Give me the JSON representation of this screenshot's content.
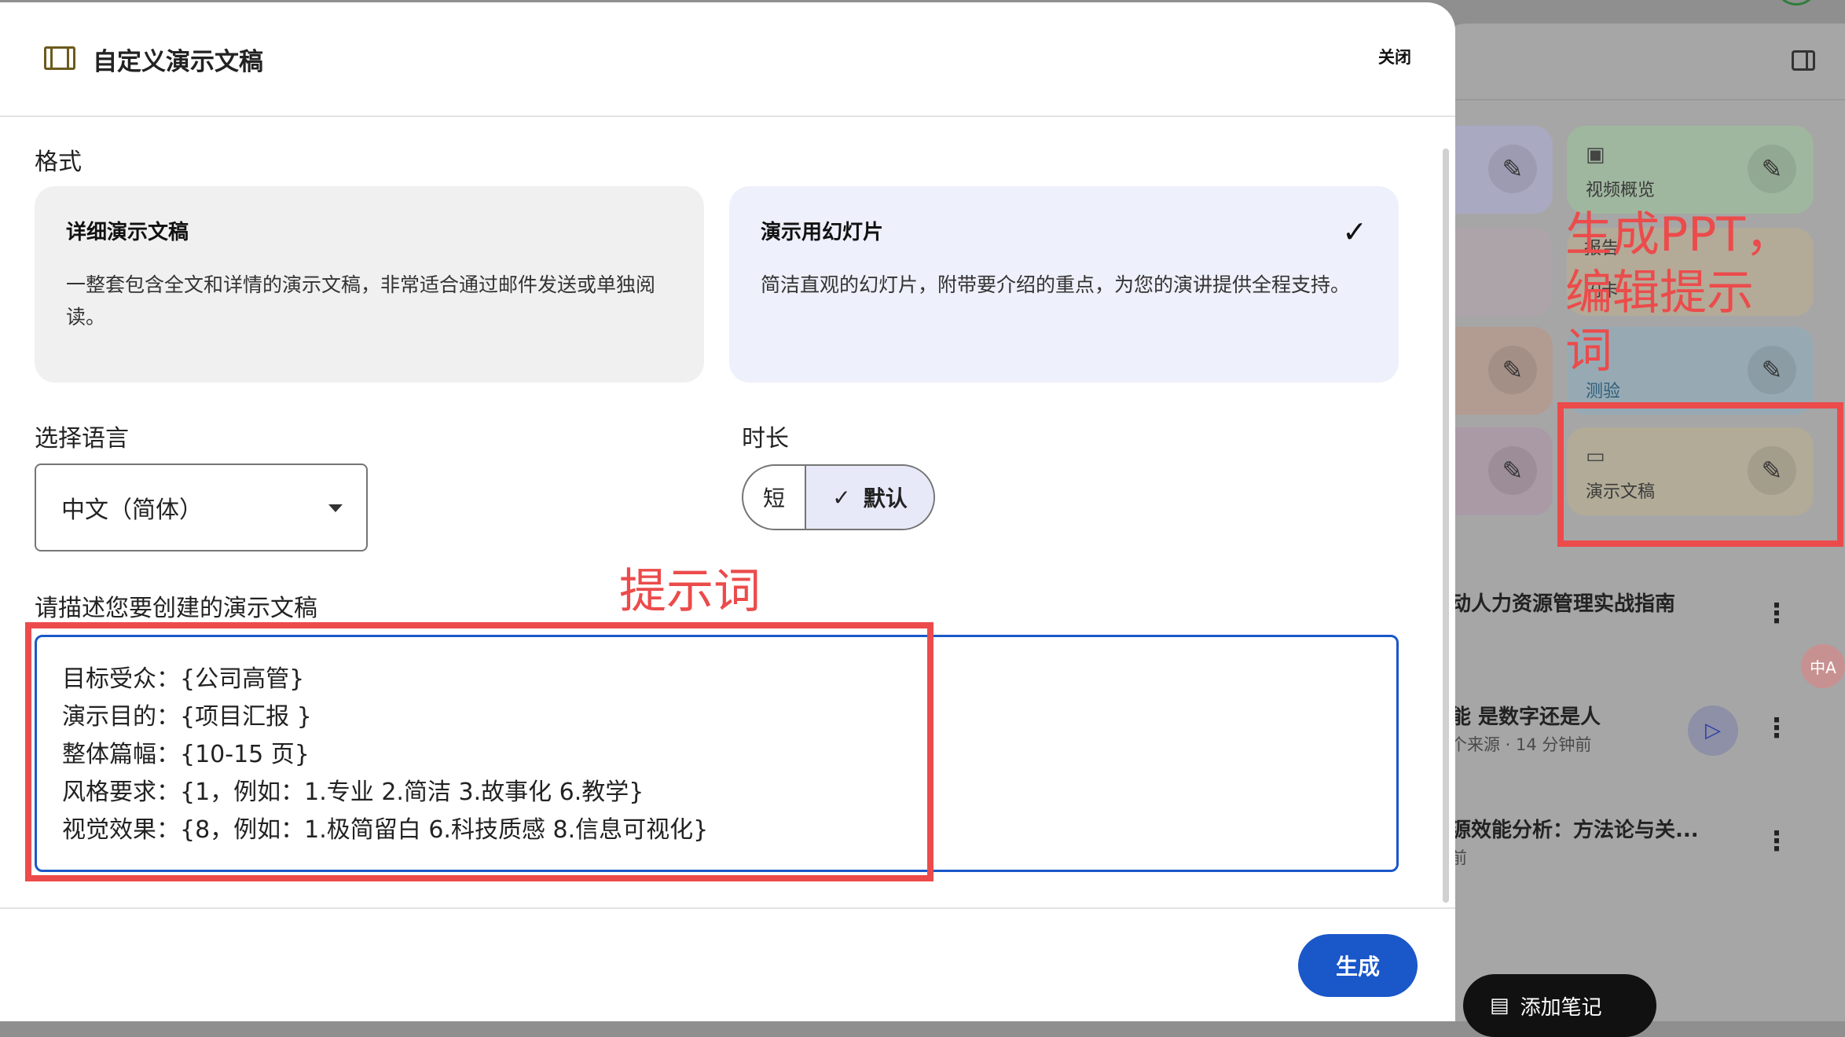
{
  "background_panel": {
    "tiles": {
      "video_overview": "视频概览",
      "tile_partial_1": "报告",
      "tile_partial_2": "闪卡",
      "quiz": "测验",
      "slides": "演示文稿"
    },
    "notes": [
      {
        "title": "动人力资源管理实战指南",
        "sub": ""
      },
      {
        "title": "能 是数字还是人",
        "sub": "个来源 · 14 分钟前"
      },
      {
        "title": "源效能分析：方法论与关...",
        "sub": "前"
      }
    ],
    "add_note_label": "添加笔记",
    "translate_badge": "中A"
  },
  "dialog": {
    "title": "自定义演示文稿",
    "close_label": "关闭",
    "format_label": "格式",
    "format_options": [
      {
        "title": "详细演示文稿",
        "desc": "一整套包含全文和详情的演示文稿，非常适合通过邮件发送或单独阅读。"
      },
      {
        "title": "演示用幻灯片",
        "desc": "简洁直观的幻灯片，附带要介绍的重点，为您的演讲提供全程支持。"
      }
    ],
    "language_label": "选择语言",
    "language_value": "中文（简体）",
    "duration_label": "时长",
    "duration_short": "短",
    "duration_default": "默认",
    "prompt_label": "请描述您要创建的演示文稿",
    "prompt_text": "目标受众：{公司高管}\n演示目的：{项目汇报 }\n整体篇幅：{10-15 页}\n风格要求：{1，例如：1.专业 2.简洁 3.故事化 6.教学}\n视觉效果：{8，例如：1.极简留白 6.科技质感 8.信息可视化}",
    "generate_label": "生成"
  },
  "annotations": {
    "prompt_note": "提示词",
    "ppt_note": "生成PPT，\n编辑提示\n词",
    "color": "#ec4b4b"
  },
  "colors": {
    "accent": "#1a57c9",
    "selected_card": "#eef0fb"
  }
}
